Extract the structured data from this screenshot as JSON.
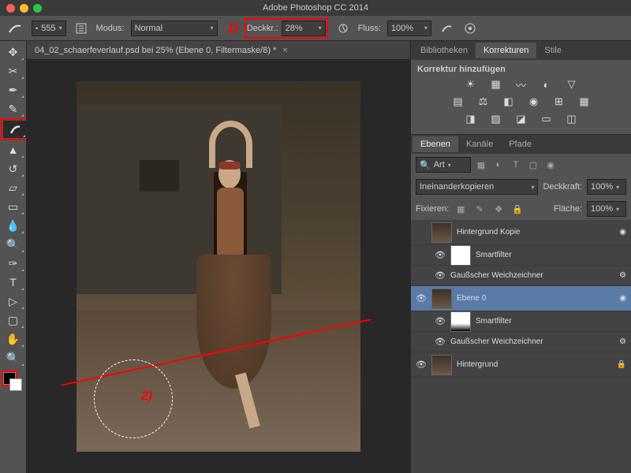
{
  "title": "Adobe Photoshop CC 2014",
  "optionsBar": {
    "brushSize": "555",
    "modusLabel": "Modus:",
    "modusValue": "Normal",
    "opacityLabel": "Deckkr.:",
    "opacityValue": "28%",
    "flowLabel": "Fluss:",
    "flowValue": "100%"
  },
  "annotations": {
    "a1": "1)",
    "a2": "2)"
  },
  "document": {
    "tab": "04_02_schaerfeverlauf.psd bei 25% (Ebene 0, Filtermaske/8) *"
  },
  "panelTabs": {
    "libraries": "Bibliotheken",
    "adjustments": "Korrekturen",
    "styles": "Stile",
    "layers": "Ebenen",
    "channels": "Kanäle",
    "paths": "Pfade"
  },
  "adjustments": {
    "heading": "Korrektur hinzufügen"
  },
  "layersPanel": {
    "searchKind": "Art",
    "blendMode": "Ineinanderkopieren",
    "opacityLabel": "Deckkraft:",
    "opacityValue": "100%",
    "lockLabel": "Fixieren:",
    "fillLabel": "Fläche:",
    "fillValue": "100%",
    "layers": [
      {
        "name": "Hintergrund Kopie"
      },
      {
        "name": "Smartfilter"
      },
      {
        "name": "Gaußscher Weichzeichner"
      },
      {
        "name": "Ebene 0"
      },
      {
        "name": "Smartfilter"
      },
      {
        "name": "Gaußscher Weichzeichner"
      },
      {
        "name": "Hintergrund"
      }
    ]
  }
}
